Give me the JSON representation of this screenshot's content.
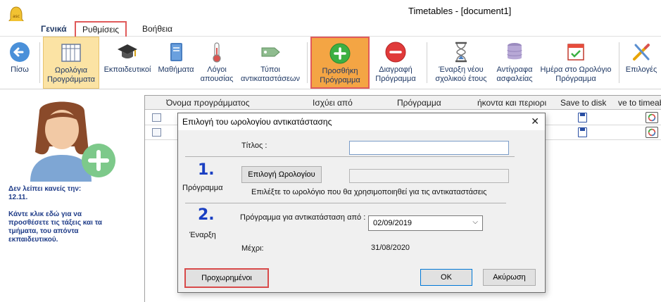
{
  "window": {
    "title": "Timetables - [document1]"
  },
  "tabs": [
    {
      "label": "Γενικά"
    },
    {
      "label": "Ρυθμίσεις"
    },
    {
      "label": "Βοήθεια"
    }
  ],
  "ribbon": {
    "back": "Πίσω",
    "timetables": "Ωρολόγια Προγράμματα",
    "teachers": "Εκπαιδευτικοί",
    "subjects": "Μαθήματα",
    "absence_reasons": "Λόγοι απουσίας",
    "substitution_types": "Τύποι αντικαταστάσεων",
    "add_schedule": "Προσθήκη Πρόγραμμα",
    "delete_schedule": "Διαγραφή Πρόγραμμα",
    "new_year": "Έναρξη νέου σχολικού έτους",
    "backups": "Αντίγραφα ασφαλείας",
    "day_in_schedule": "Ημέρα στο Ωρολόγιο Πρόγραμμα",
    "options": "Επιλογές"
  },
  "left_panel": {
    "line1": "Δεν λείπει κανείς την:",
    "line2": "12.11.",
    "line3": "Κάντε κλικ εδώ για να προσθέσετε τις τάξεις και τα τμήματα, του απόντα εκπαιδευτικού."
  },
  "grid": {
    "columns": [
      "Όνομα προγράμματος",
      "Ισχύει από",
      "Πρόγραμμα",
      "ήκοντα και περιορι",
      "Save to disk",
      "ve to timeab"
    ]
  },
  "dialog": {
    "title": "Επιλογή του ωρολογίου αντικατάστασης",
    "title_label": "Τίτλος :",
    "title_value": "",
    "step1_number": "1.",
    "step1_label": "Πρόγραμμα",
    "choose_button": "Επιλογή Ωρολογίου",
    "choose_hint": "Επιλέξτε το ωρολόγιο που θα χρησιμοποιηθεί για τις αντικαταστάσεις",
    "step2_number": "2.",
    "step2_label": "Έναρξη",
    "from_label": "Πρόγραμμα για αντικατάσταση από :",
    "from_date": "02/09/2019",
    "until_label": "Μέχρι:",
    "until_date": "31/08/2020",
    "advanced_button": "Προχωρημένοι",
    "ok_button": "OK",
    "cancel_button": "Ακύρωση"
  }
}
